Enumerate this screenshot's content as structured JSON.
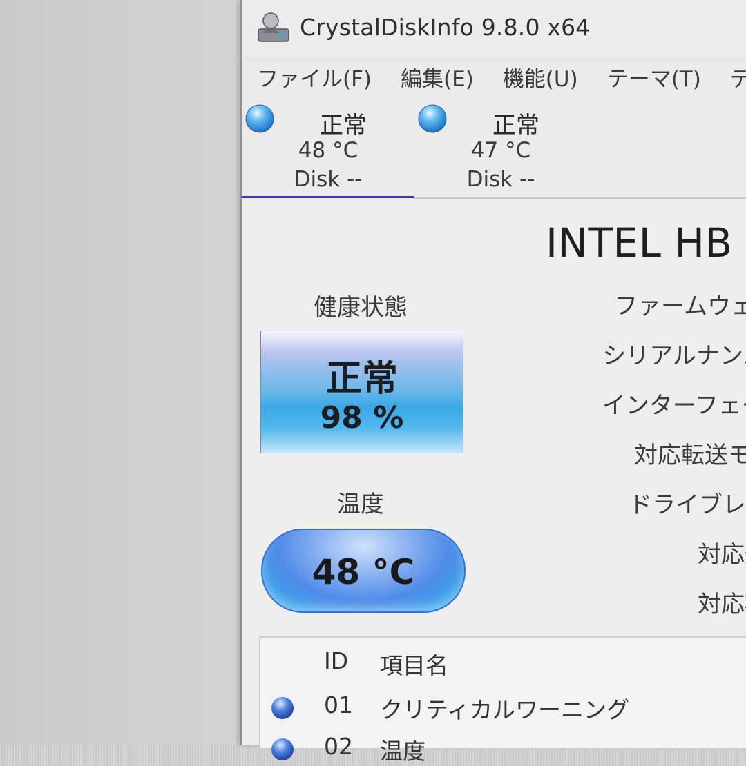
{
  "window": {
    "title": "CrystalDiskInfo 9.8.0 x64"
  },
  "menu": [
    {
      "label": "ファイル(F)"
    },
    {
      "label": "編集(E)"
    },
    {
      "label": "機能(U)"
    },
    {
      "label": "テーマ(T)"
    },
    {
      "label": "ディ"
    }
  ],
  "disks": [
    {
      "status": "正常",
      "temp": "48 °C",
      "label": "Disk --",
      "active": true
    },
    {
      "status": "正常",
      "temp": "47 °C",
      "label": "Disk --",
      "active": false
    }
  ],
  "main": {
    "model": "INTEL HB",
    "health_label": "健康状態",
    "health_status": "正常",
    "health_percent": "98 %",
    "temp_label": "温度",
    "temp_value": "48 °C",
    "info_labels": [
      "ファームウェア",
      "シリアルナンバー",
      "インターフェース",
      "対応転送モード",
      "ドライブレター",
      "対応規格",
      "対応機能"
    ]
  },
  "smart_table": {
    "headers": {
      "id": "ID",
      "name": "項目名"
    },
    "rows": [
      {
        "id": "01",
        "name": "クリティカルワーニング"
      },
      {
        "id": "02",
        "name": "温度"
      }
    ]
  },
  "colors": {
    "health_good": "#3aa8e6",
    "status_orb": "#2f86d8",
    "active_tab_underline": "#3c37a8"
  },
  "icons": {
    "app": "crystaldiskinfo-icon",
    "status_orb": "status-orb-icon"
  }
}
